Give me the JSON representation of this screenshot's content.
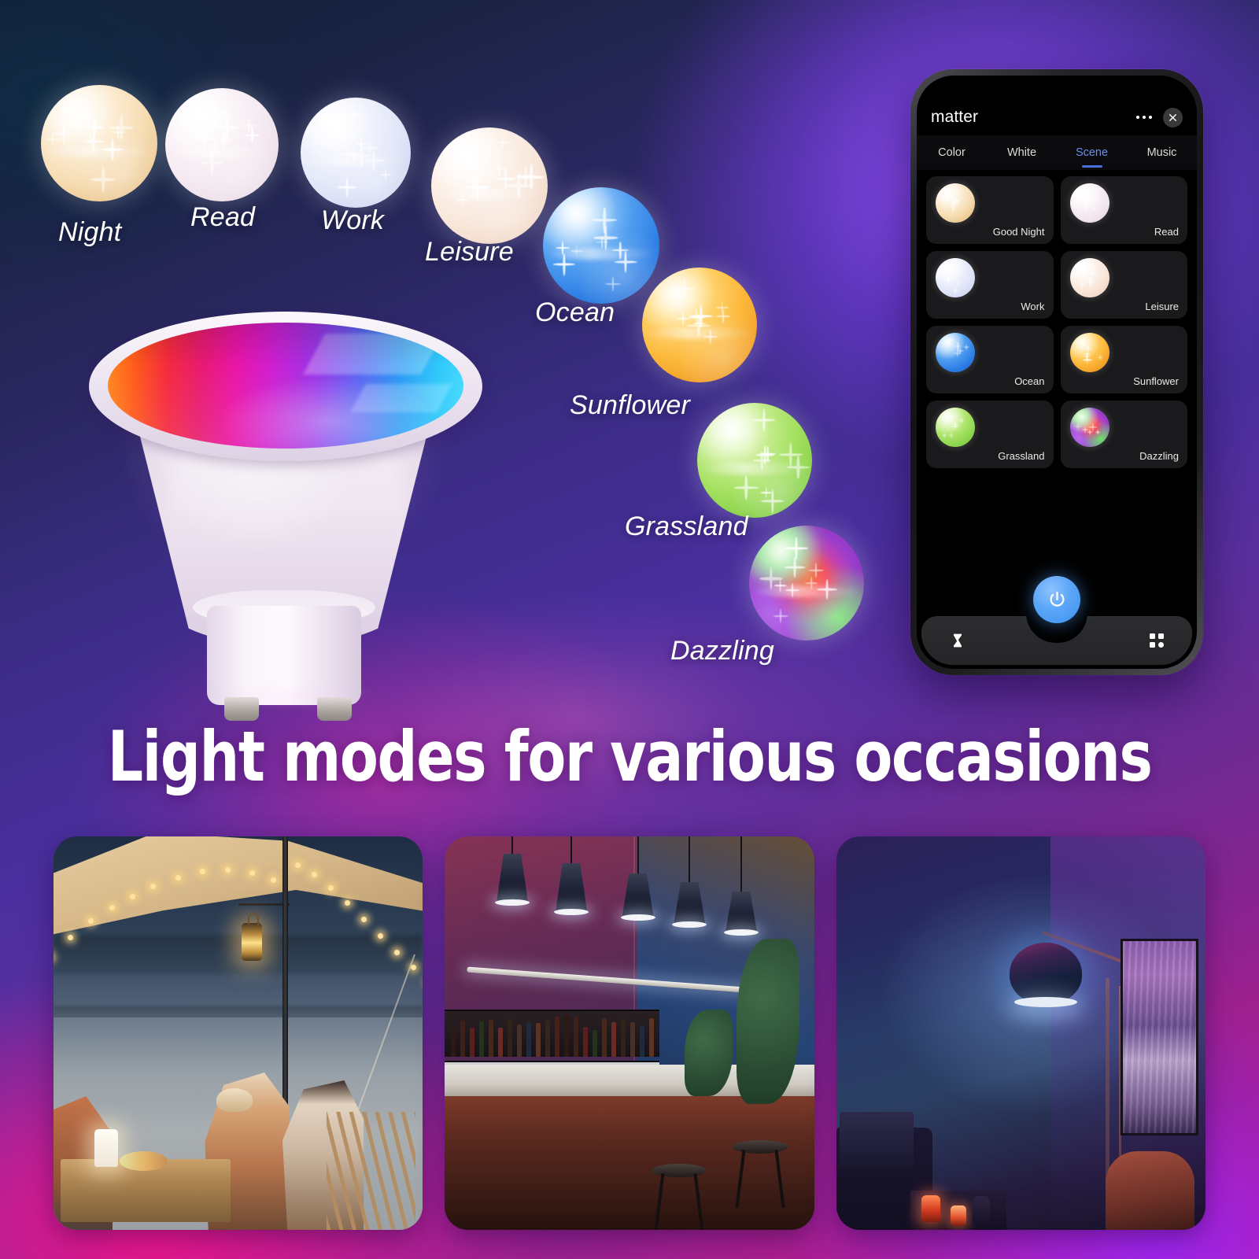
{
  "headline": "Light modes for various occasions",
  "scene_arc": {
    "items": [
      {
        "label": "Night",
        "color": "#f3d7b0"
      },
      {
        "label": "Read",
        "color": "#f4e6ee"
      },
      {
        "label": "Work",
        "color": "#e2e6f7"
      },
      {
        "label": "Leisure",
        "color": "#f7e3dc"
      },
      {
        "label": "Ocean",
        "color": "#3f8ee8"
      },
      {
        "label": "Sunflower",
        "color": "#f7b13c"
      },
      {
        "label": "Grassland",
        "color": "#97dc6a"
      },
      {
        "label": "Dazzling",
        "color": "#c24fd6"
      }
    ]
  },
  "phone": {
    "app_title": "matter",
    "header_icons": {
      "more": "more-dots-icon",
      "close": "close-icon"
    },
    "tabs": [
      {
        "label": "Color",
        "active": false
      },
      {
        "label": "White",
        "active": false
      },
      {
        "label": "Scene",
        "active": true
      },
      {
        "label": "Music",
        "active": false
      }
    ],
    "active_tab_color": "#6e90ea",
    "scenes": [
      {
        "label": "Good Night",
        "color": "#f0d6ab"
      },
      {
        "label": "Read",
        "color": "#f1e3ea"
      },
      {
        "label": "Work",
        "color": "#dfe3f6"
      },
      {
        "label": "Leisure",
        "color": "#f6e2dd"
      },
      {
        "label": "Ocean",
        "color": "#3b86e4"
      },
      {
        "label": "Sunflower",
        "color": "#f5b03b"
      },
      {
        "label": "Grassland",
        "color": "#9add6c"
      },
      {
        "label": "Dazzling",
        "color": "#c24fd6"
      }
    ],
    "power_button": {
      "icon": "power-icon",
      "color": "#5aa5f7"
    },
    "nav": [
      {
        "icon": "timer-hourglass-icon"
      },
      {
        "icon": "apps-grid-icon"
      }
    ]
  },
  "product": {
    "name": "gu10-rgb-smart-bulb",
    "face_gradient": [
      "#ff8a1e",
      "#f52a3e",
      "#e915a8",
      "#9b35e8",
      "#2a9bf5",
      "#45d9fc"
    ]
  },
  "photos": [
    {
      "name": "camping-scene",
      "caption": ""
    },
    {
      "name": "bar-scene",
      "caption": ""
    },
    {
      "name": "bedroom-scene",
      "caption": ""
    }
  ],
  "theme": {
    "bg_top_left": "#132034",
    "bg_mid": "#5a2f9e",
    "bg_bottom_left": "#e4148c",
    "bg_bottom_right": "#8c2ce0",
    "accent_blue": "#5aa5f7",
    "text_white": "#ffffff"
  }
}
